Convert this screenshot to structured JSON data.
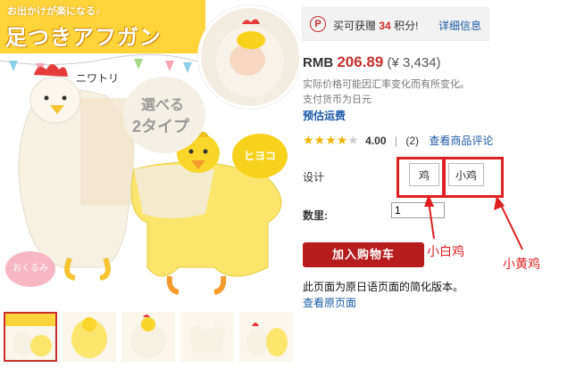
{
  "product_image": {
    "banner_sub": "お出かけが楽になる♪",
    "banner_title": "足つきアフガン",
    "label_niwatori": "ニワトリ",
    "select_two_line1": "選べる",
    "select_two_line2": "2タイプ",
    "badge_hiyoko": "ヒヨコ",
    "badge_okurumi": "おくるみ",
    "colors": {
      "banner": "#ffd33a",
      "chick": "#f6d21d",
      "cream": "#f3ece0"
    }
  },
  "thumbnails": [
    {
      "name": "thumbnail-1",
      "selected": true
    },
    {
      "name": "thumbnail-2",
      "selected": false
    },
    {
      "name": "thumbnail-3",
      "selected": false
    },
    {
      "name": "thumbnail-4",
      "selected": false
    },
    {
      "name": "thumbnail-5",
      "selected": false
    }
  ],
  "points": {
    "icon_letter": "P",
    "prefix": "买可获赠",
    "value": "34",
    "suffix": "积分!",
    "detail_link": "详细信息"
  },
  "price": {
    "currency": "RMB",
    "amount": "206.89",
    "jpy": "(¥ 3,434)",
    "note_line1": "实际价格可能因汇率变化而有所变化。",
    "note_line2": "支付货币为日元",
    "shipping_link": "预估运费"
  },
  "rating": {
    "stars_filled": 4,
    "stars_total": 5,
    "score": "4.00",
    "count": "(2)",
    "review_link": "查看商品评论"
  },
  "options": {
    "design_label": "设计",
    "option1": "鸡",
    "option2": "小鸡"
  },
  "quantity": {
    "label": "数里:",
    "value": "1"
  },
  "cart": {
    "button_label": "加入购物车"
  },
  "footer": {
    "simplified_note": "此页面为原日语页面的简化版本。",
    "original_link": "查看原页面"
  },
  "annotations": {
    "label1": "小白鸡",
    "label2": "小黄鸡",
    "color": "#e02020"
  }
}
